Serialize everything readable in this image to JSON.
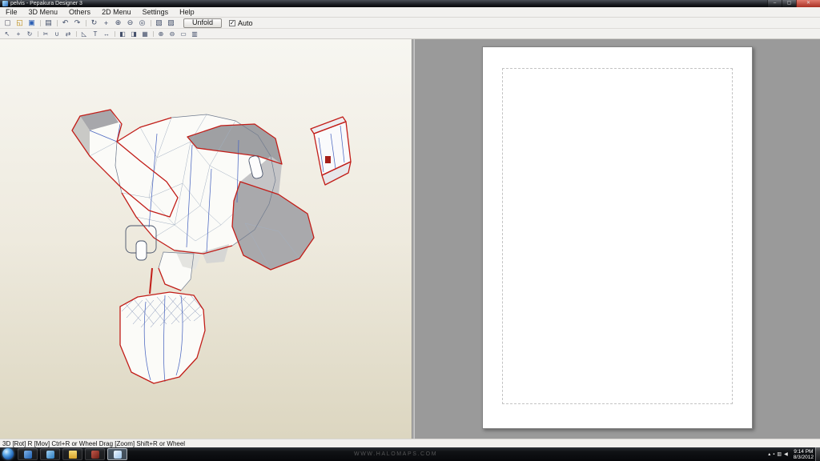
{
  "window": {
    "title": "pelvis - Pepakura Designer 3",
    "minimize_glyph": "–",
    "maximize_glyph": "▢",
    "close_glyph": "✕"
  },
  "menu": {
    "items": [
      "File",
      "3D Menu",
      "Others",
      "2D Menu",
      "Settings",
      "Help"
    ]
  },
  "toolbar_main": {
    "icons": [
      {
        "name": "new-file-icon",
        "glyph": "▢"
      },
      {
        "name": "open-file-icon",
        "glyph": "◱"
      },
      {
        "name": "save-file-icon",
        "glyph": "▣"
      },
      {
        "name": "toolbar-separator",
        "glyph": ""
      },
      {
        "name": "print-icon",
        "glyph": "▤"
      },
      {
        "name": "toolbar-separator",
        "glyph": ""
      },
      {
        "name": "undo-icon",
        "glyph": "↶"
      },
      {
        "name": "redo-icon",
        "glyph": "↷"
      },
      {
        "name": "toolbar-separator",
        "glyph": ""
      },
      {
        "name": "rotate-view-icon",
        "glyph": "↻"
      },
      {
        "name": "pan-view-icon",
        "glyph": "+"
      },
      {
        "name": "zoom-in-icon",
        "glyph": "⊕"
      },
      {
        "name": "zoom-out-icon",
        "glyph": "⊖"
      },
      {
        "name": "fit-view-icon",
        "glyph": "◎"
      },
      {
        "name": "toolbar-separator",
        "glyph": ""
      },
      {
        "name": "display-mode-icon",
        "glyph": "▧"
      },
      {
        "name": "texture-view-icon",
        "glyph": "▨"
      }
    ],
    "unfold_label": "Unfold",
    "auto_label": "Auto",
    "auto_check": "✓"
  },
  "toolbar_2d": {
    "icons": [
      {
        "name": "select-parts-icon",
        "glyph": "↖"
      },
      {
        "name": "move-parts-icon",
        "glyph": "+"
      },
      {
        "name": "rotate-parts-icon",
        "glyph": "↻"
      },
      {
        "name": "toolbar-separator",
        "glyph": ""
      },
      {
        "name": "divide-edge-icon",
        "glyph": "✂"
      },
      {
        "name": "join-edge-icon",
        "glyph": "∪"
      },
      {
        "name": "flip-parts-icon",
        "glyph": "⇄"
      },
      {
        "name": "toolbar-separator",
        "glyph": ""
      },
      {
        "name": "edit-flaps-icon",
        "glyph": "◺"
      },
      {
        "name": "add-text-icon",
        "glyph": "T"
      },
      {
        "name": "measure-icon",
        "glyph": "↔"
      },
      {
        "name": "toolbar-separator",
        "glyph": ""
      },
      {
        "name": "align-left-icon",
        "glyph": "◧"
      },
      {
        "name": "align-right-icon",
        "glyph": "◨"
      },
      {
        "name": "grid-icon",
        "glyph": "▦"
      },
      {
        "name": "toolbar-separator",
        "glyph": ""
      },
      {
        "name": "zoom-2d-in-icon",
        "glyph": "⊕"
      },
      {
        "name": "zoom-2d-out-icon",
        "glyph": "⊖"
      },
      {
        "name": "fit-page-icon",
        "glyph": "▭"
      },
      {
        "name": "print-preview-icon",
        "glyph": "▥"
      }
    ]
  },
  "statusbar": {
    "text": "3D [Rot] R [Mov] Ctrl+R or Wheel Drag [Zoom] Shift+R or Wheel"
  },
  "taskbar": {
    "watermark": "WWW.HALOMAPS.COM",
    "clock_time": "9:14 PM",
    "clock_date": "8/3/2012",
    "tray": [
      {
        "name": "show-hidden-icons-icon",
        "glyph": "▴"
      },
      {
        "name": "action-center-icon",
        "glyph": "▪"
      },
      {
        "name": "network-icon",
        "glyph": "▥"
      },
      {
        "name": "volume-icon",
        "glyph": "◀"
      }
    ]
  },
  "colors": {
    "cut_edge": "#c21d18",
    "fold_edge": "#4a66c0",
    "view3d_bg_bottom": "#dcd6c0",
    "view2d_bg": "#9a9a9a"
  }
}
